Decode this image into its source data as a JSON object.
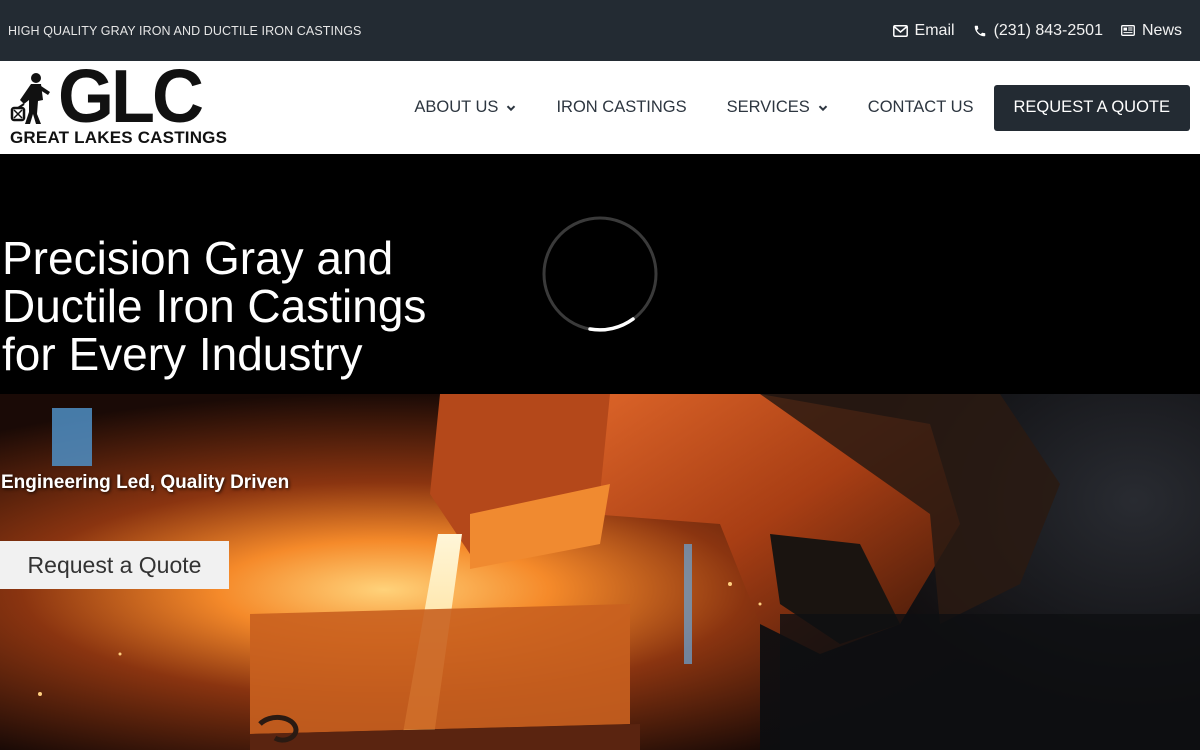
{
  "topbar": {
    "tagline": "HIGH QUALITY GRAY IRON AND DUCTILE IRON CASTINGS",
    "links": [
      {
        "label": "Email",
        "icon": "envelope-icon"
      },
      {
        "label": "(231) 843-2501",
        "icon": "phone-icon"
      },
      {
        "label": "News",
        "icon": "newspaper-icon"
      }
    ]
  },
  "logo": {
    "mark": "GLC",
    "name": "GREAT LAKES CASTINGS"
  },
  "nav": {
    "items": [
      {
        "label": "ABOUT US",
        "dropdown": true
      },
      {
        "label": "IRON CASTINGS",
        "dropdown": false
      },
      {
        "label": "SERVICES",
        "dropdown": true
      },
      {
        "label": "CONTACT US",
        "dropdown": false
      }
    ],
    "cta": "REQUEST A QUOTE"
  },
  "hero": {
    "title": "Precision Gray and Ductile Iron Castings for Every Industry",
    "subtitle": "Engineering Led, Quality Driven",
    "button": "Request a Quote"
  },
  "colors": {
    "dark": "#232b33",
    "white": "#ffffff",
    "molten": "#ff7a1a"
  }
}
